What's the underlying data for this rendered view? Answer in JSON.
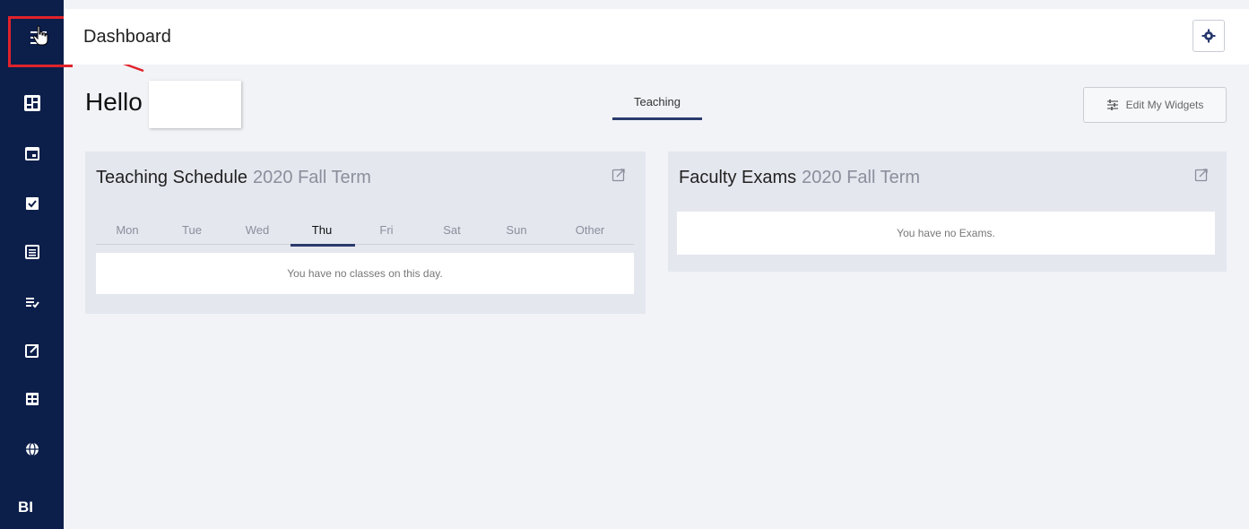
{
  "header": {
    "title": "Dashboard"
  },
  "greeting": {
    "hello": "Hello"
  },
  "tabs": {
    "teaching": "Teaching"
  },
  "actions": {
    "edit_widgets": "Edit My Widgets"
  },
  "sidebar": {
    "icons": [
      "dashboard-icon",
      "calendar-icon",
      "checkbox-icon",
      "list-icon",
      "checklist-icon",
      "external-link-icon",
      "table-icon",
      "globe-icon"
    ],
    "bi_label": "BI"
  },
  "teaching_schedule": {
    "title": "Teaching Schedule",
    "term": "2020 Fall Term",
    "days": [
      "Mon",
      "Tue",
      "Wed",
      "Thu",
      "Fri",
      "Sat",
      "Sun",
      "Other"
    ],
    "active_day": "Thu",
    "empty_message": "You have no classes on this day."
  },
  "faculty_exams": {
    "title": "Faculty Exams",
    "term": "2020 Fall Term",
    "empty_message": "You have no Exams."
  },
  "colors": {
    "sidebar": "#0c1e4a",
    "highlight": "#e0222b",
    "accent": "#2a3a6e"
  }
}
